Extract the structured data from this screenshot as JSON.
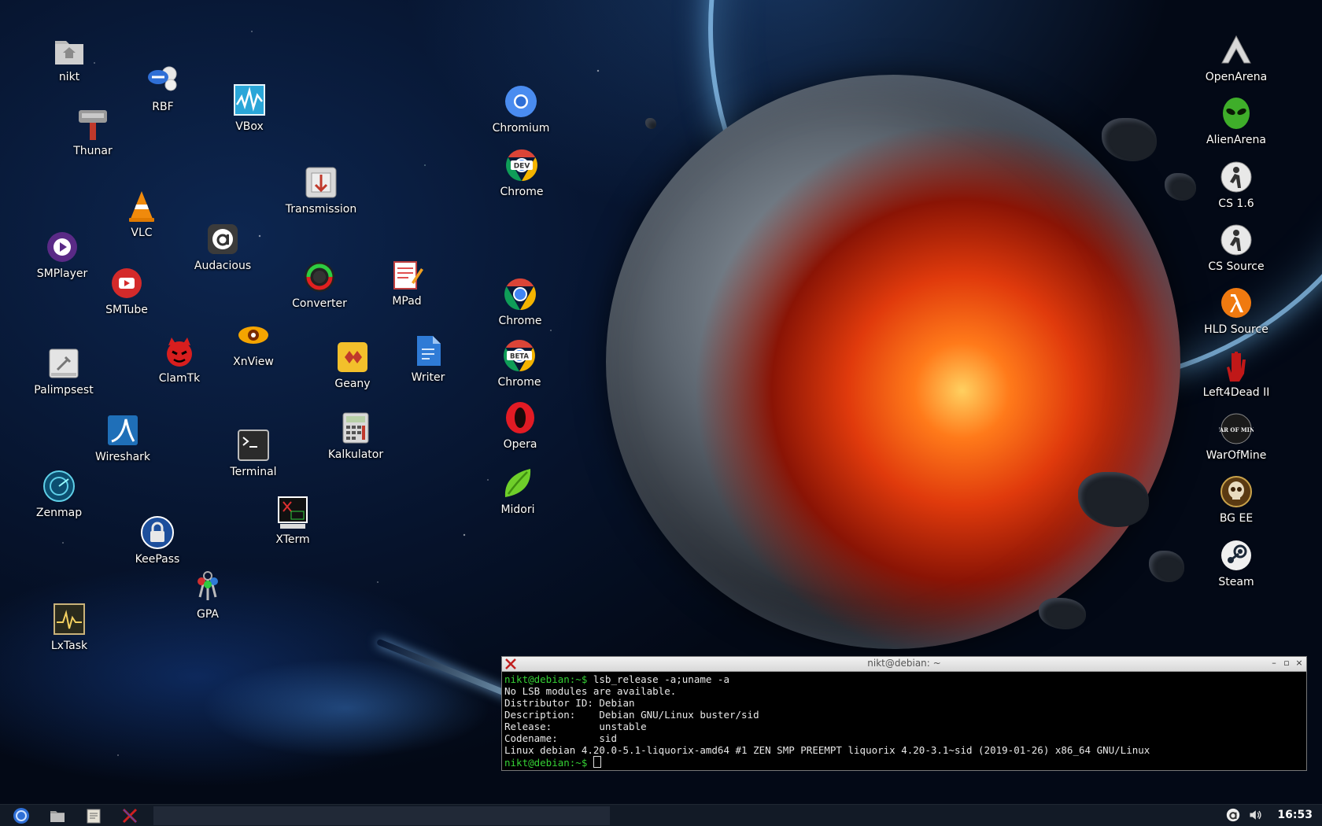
{
  "desktop": {
    "icons": {
      "nikt": "nikt",
      "rbf": "RBF",
      "thunar": "Thunar",
      "vbox": "VBox",
      "transmission": "Transmission",
      "vlc": "VLC",
      "audacious": "Audacious",
      "smplayer": "SMPlayer",
      "smtube": "SMTube",
      "converter": "Converter",
      "mpad": "MPad",
      "xnview": "XnView",
      "clamtk": "ClamTk",
      "palimpsest": "Palimpsest",
      "geany": "Geany",
      "writer": "Writer",
      "wireshark": "Wireshark",
      "terminal": "Terminal",
      "kalkulator": "Kalkulator",
      "zenmap": "Zenmap",
      "xterm": "XTerm",
      "keepass": "KeePass",
      "gpa": "GPA",
      "lxtask": "LxTask",
      "chromium": "Chromium",
      "chrome_dev": "Chrome",
      "chrome": "Chrome",
      "chrome_beta": "Chrome",
      "opera": "Opera",
      "midori": "Midori",
      "openarena": "OpenArena",
      "alienarena": "AlienArena",
      "cs16": "CS 1.6",
      "cssource": "CS Source",
      "hldsource": "HLD Source",
      "left4dead": "Left4Dead II",
      "warofmine": "WarOfMine",
      "bgee": "BG EE",
      "steam": "Steam"
    },
    "badges": {
      "dev": "DEV",
      "beta": "BETA",
      "war_of_mine": "WAR OF MINE"
    }
  },
  "terminal": {
    "title": "nikt@debian: ~",
    "prompt": "nikt@debian:~$",
    "command": " lsb_release -a;uname -a",
    "output": [
      "No LSB modules are available.",
      "Distributor ID: Debian",
      "Description:    Debian GNU/Linux buster/sid",
      "Release:        unstable",
      "Codename:       sid",
      "Linux debian 4.20.0-5.1-liquorix-amd64 #1 ZEN SMP PREEMPT liquorix 4.20-3.1~sid (2019-01-26) x86_64 GNU/Linux"
    ],
    "prompt2": "nikt@debian:~$",
    "buttons": {
      "minimize": "–",
      "maximize": "▫",
      "close": "×"
    }
  },
  "taskbar": {
    "clock": "16:53"
  },
  "colors": {
    "prompt": "#35d135",
    "taskbar": "#141c28"
  }
}
